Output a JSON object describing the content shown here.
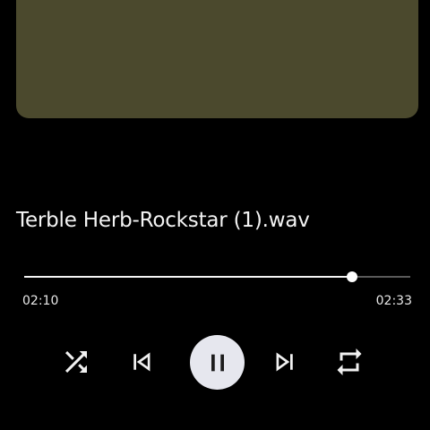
{
  "player": {
    "track_title": "Terble Herb-Rockstar (1).wav",
    "elapsed": "02:10",
    "total": "02:33",
    "progress": 0.85,
    "state": "playing"
  },
  "controls": {
    "shuffle": "shuffle-icon",
    "previous": "skip-previous-icon",
    "play_pause": "pause-icon",
    "next": "skip-next-icon",
    "repeat": "repeat-icon"
  },
  "colors": {
    "background": "#000000",
    "artwork": "#4b492d",
    "play_button": "#e6e7ee",
    "progress_fill": "#f5f5f5",
    "progress_track": "#5a5a5a"
  }
}
